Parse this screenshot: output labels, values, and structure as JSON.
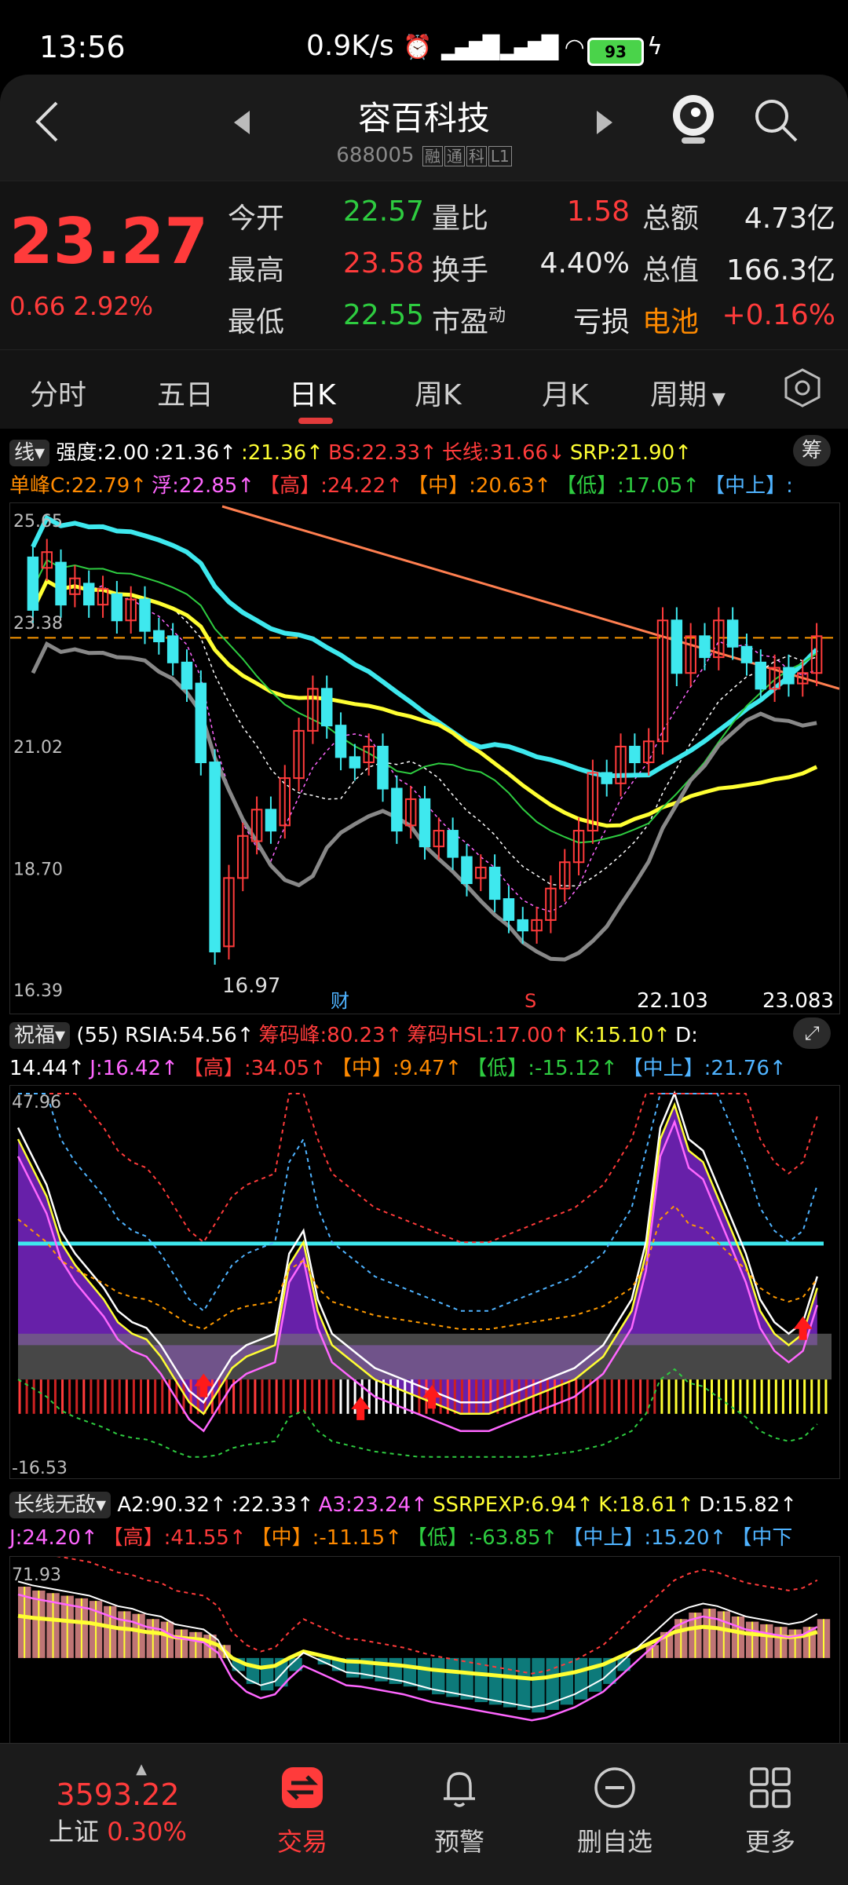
{
  "status_bar": {
    "time": "13:56",
    "speed": "0.9K/s",
    "battery": "93"
  },
  "header": {
    "title": "容百科技",
    "code": "688005",
    "tags": [
      "融",
      "通",
      "科",
      "L1"
    ]
  },
  "quote": {
    "price": "23.27",
    "change": "0.66",
    "change_pct": "2.92%",
    "rows": [
      [
        {
          "label": "今开",
          "value": "22.57",
          "color": "green"
        },
        {
          "label": "量比",
          "value": "1.58",
          "color": "red"
        },
        {
          "label": "总额",
          "value": "4.73亿",
          "color": "white"
        }
      ],
      [
        {
          "label": "最高",
          "value": "23.58",
          "color": "red"
        },
        {
          "label": "换手",
          "value": "4.40%",
          "color": "white"
        },
        {
          "label": "总值",
          "value": "166.3亿",
          "color": "white"
        }
      ],
      [
        {
          "label": "最低",
          "value": "22.55",
          "color": "green"
        },
        {
          "label": "市盈",
          "value": "亏损",
          "color": "white"
        },
        {
          "label": "电池",
          "value": "+0.16%",
          "color": "red"
        }
      ]
    ],
    "pe_sup": "动"
  },
  "tabs": [
    "分时",
    "五日",
    "日K",
    "周K",
    "月K",
    "周期"
  ],
  "active_tab": "日K",
  "panel1": {
    "selector": "线",
    "line1": [
      {
        "t": "强度:2.00",
        "c": "#ffffff"
      },
      {
        "t": ":21.36↑",
        "c": "#ffffff"
      },
      {
        "t": ":21.36↑",
        "c": "#ffff33"
      },
      {
        "t": "BS:22.33↑",
        "c": "#ff3b3b"
      },
      {
        "t": "长线:31.66↓",
        "c": "#ff3b3b"
      },
      {
        "t": "SRP:21.90↑",
        "c": "#ffff33"
      }
    ],
    "line2": [
      {
        "t": "单峰C:22.79↑",
        "c": "#ff8a00"
      },
      {
        "t": "浮:22.85↑",
        "c": "#ff66ff"
      },
      {
        "t": "【高】:24.22↑",
        "c": "#ff3b3b"
      },
      {
        "t": "【中】:20.63↑",
        "c": "#ff8a00"
      },
      {
        "t": "【低】:17.05↑",
        "c": "#2ecc40"
      },
      {
        "t": "【中上】:",
        "c": "#4fb3ff"
      }
    ],
    "corner_btn": "筹",
    "y_labels": [
      "25.65",
      "23.38",
      "21.02",
      "18.70",
      "16.39"
    ],
    "low_label": "16.97",
    "bottom_labels": [
      "财",
      "S",
      "22.103",
      "23.083"
    ],
    "candles": [
      {
        "o": 24.8,
        "c": 23.8
      },
      {
        "o": 24.6,
        "c": 24.9
      },
      {
        "o": 24.7,
        "c": 23.9
      },
      {
        "o": 24.1,
        "c": 24.4
      },
      {
        "o": 24.3,
        "c": 23.9
      },
      {
        "o": 23.9,
        "c": 24.2
      },
      {
        "o": 24.1,
        "c": 23.6
      },
      {
        "o": 23.6,
        "c": 24.0
      },
      {
        "o": 24.0,
        "c": 23.4
      },
      {
        "o": 23.4,
        "c": 23.2
      },
      {
        "o": 23.3,
        "c": 22.8
      },
      {
        "o": 22.8,
        "c": 22.3
      },
      {
        "o": 22.4,
        "c": 20.9
      },
      {
        "o": 20.9,
        "c": 17.3
      },
      {
        "o": 17.4,
        "c": 18.7
      },
      {
        "o": 18.7,
        "c": 19.5
      },
      {
        "o": 19.4,
        "c": 20.0
      },
      {
        "o": 20.0,
        "c": 19.6
      },
      {
        "o": 19.7,
        "c": 20.6
      },
      {
        "o": 20.6,
        "c": 21.5
      },
      {
        "o": 21.5,
        "c": 22.3
      },
      {
        "o": 22.3,
        "c": 21.6
      },
      {
        "o": 21.6,
        "c": 21.0
      },
      {
        "o": 21.0,
        "c": 20.8
      },
      {
        "o": 20.9,
        "c": 21.2
      },
      {
        "o": 21.2,
        "c": 20.4
      },
      {
        "o": 20.4,
        "c": 19.6
      },
      {
        "o": 19.7,
        "c": 20.2
      },
      {
        "o": 20.2,
        "c": 19.3
      },
      {
        "o": 19.3,
        "c": 19.6
      },
      {
        "o": 19.6,
        "c": 19.1
      },
      {
        "o": 19.1,
        "c": 18.6
      },
      {
        "o": 18.7,
        "c": 18.9
      },
      {
        "o": 18.9,
        "c": 18.3
      },
      {
        "o": 18.3,
        "c": 17.9
      },
      {
        "o": 17.9,
        "c": 17.7
      },
      {
        "o": 17.7,
        "c": 17.9
      },
      {
        "o": 17.9,
        "c": 18.5
      },
      {
        "o": 18.5,
        "c": 19.0
      },
      {
        "o": 19.0,
        "c": 19.6
      },
      {
        "o": 19.6,
        "c": 20.7
      },
      {
        "o": 20.7,
        "c": 20.5
      },
      {
        "o": 20.5,
        "c": 21.2
      },
      {
        "o": 21.2,
        "c": 20.9
      },
      {
        "o": 20.9,
        "c": 21.3
      },
      {
        "o": 21.3,
        "c": 23.6
      },
      {
        "o": 23.6,
        "c": 22.6
      },
      {
        "o": 22.6,
        "c": 23.3
      },
      {
        "o": 23.3,
        "c": 22.9
      },
      {
        "o": 22.9,
        "c": 23.6
      },
      {
        "o": 23.6,
        "c": 23.1
      },
      {
        "o": 23.1,
        "c": 22.8
      },
      {
        "o": 22.8,
        "c": 22.3
      },
      {
        "o": 22.3,
        "c": 22.7
      },
      {
        "o": 22.7,
        "c": 22.4
      },
      {
        "o": 22.4,
        "c": 22.6
      },
      {
        "o": 22.6,
        "c": 23.3
      }
    ]
  },
  "panel2": {
    "selector": "祝福",
    "line1": [
      {
        "t": "(55) RSIA:54.56↑",
        "c": "#ffffff"
      },
      {
        "t": "筹码峰:80.23↑",
        "c": "#ff3b3b"
      },
      {
        "t": "筹码HSL:17.00↑",
        "c": "#ff3b3b"
      },
      {
        "t": "K:15.10↑",
        "c": "#ffff33"
      },
      {
        "t": "D:",
        "c": "#ffffff"
      }
    ],
    "line2": [
      {
        "t": "14.44↑",
        "c": "#ffffff"
      },
      {
        "t": "J:16.42↑",
        "c": "#ff66ff"
      },
      {
        "t": "【高】:34.05↑",
        "c": "#ff3b3b"
      },
      {
        "t": "【中】:9.47↑",
        "c": "#ff8a00"
      },
      {
        "t": "【低】:-15.12↑",
        "c": "#2ecc40"
      },
      {
        "t": "【中上】:21.76↑",
        "c": "#4fb3ff"
      }
    ],
    "y_labels": [
      "47.96",
      "-16.53"
    ]
  },
  "panel3": {
    "selector": "长线无敌",
    "line1": [
      {
        "t": "A2:90.32↑",
        "c": "#ffffff"
      },
      {
        "t": ":22.33↑",
        "c": "#ffffff"
      },
      {
        "t": "A3:23.24↑",
        "c": "#ff66ff"
      },
      {
        "t": "SSRPEXP:6.94↑",
        "c": "#ffff33"
      },
      {
        "t": "K:18.61↑",
        "c": "#ffff33"
      },
      {
        "t": "D:15.82↑",
        "c": "#ffffff"
      }
    ],
    "line2": [
      {
        "t": "J:24.20↑",
        "c": "#ff66ff"
      },
      {
        "t": "【高】:41.55↑",
        "c": "#ff3b3b"
      },
      {
        "t": "【中】:-11.15↑",
        "c": "#ff8a00"
      },
      {
        "t": "【低】:-63.85↑",
        "c": "#2ecc40"
      },
      {
        "t": "【中上】:15.20↑",
        "c": "#4fb3ff"
      },
      {
        "t": "【中下",
        "c": "#4fb3ff"
      }
    ],
    "y_labels": [
      "71.93"
    ]
  },
  "bottom_nav": {
    "index_value": "3593.22",
    "index_name": "上证",
    "index_pct": "0.30%",
    "items": [
      {
        "label": "交易",
        "icon": "trade-icon",
        "active": true
      },
      {
        "label": "预警",
        "icon": "bell-icon",
        "active": false
      },
      {
        "label": "删自选",
        "icon": "remove-watchlist-icon",
        "active": false
      },
      {
        "label": "更多",
        "icon": "grid-icon",
        "active": false
      }
    ]
  },
  "colors": {
    "up": "#ff3b3b",
    "down": "#3ee8ee",
    "accent": "#e23b3b"
  }
}
